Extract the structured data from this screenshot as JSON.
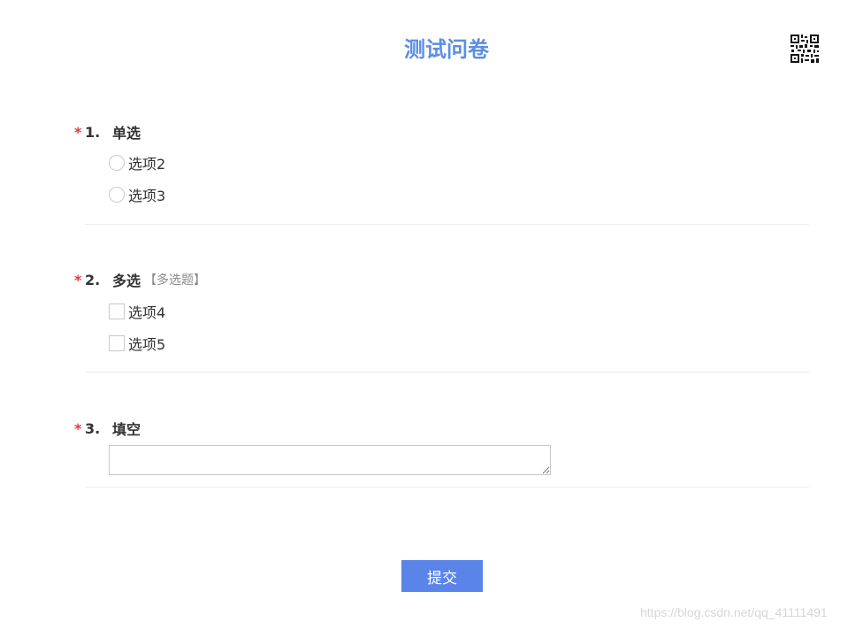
{
  "survey": {
    "title": "测试问卷",
    "qr_code_icon": "qr-code-icon"
  },
  "questions": [
    {
      "required_mark": "*",
      "number": "1.",
      "title": "单选",
      "tip": "",
      "type": "radio",
      "options": [
        "选项2",
        "选项3"
      ],
      "selected": null
    },
    {
      "required_mark": "*",
      "number": "2.",
      "title": "多选",
      "tip": "【多选题】",
      "type": "checkbox",
      "options": [
        "选项4",
        "选项5"
      ],
      "checked": []
    },
    {
      "required_mark": "*",
      "number": "3.",
      "title": "填空",
      "tip": "",
      "type": "textarea",
      "value": ""
    }
  ],
  "submit": {
    "label": "提交"
  },
  "watermark": "https://blog.csdn.net/qq_41111491",
  "colors": {
    "title": "#5b8ee6",
    "required": "#e8373e",
    "submit_bg": "#5b84e8"
  }
}
